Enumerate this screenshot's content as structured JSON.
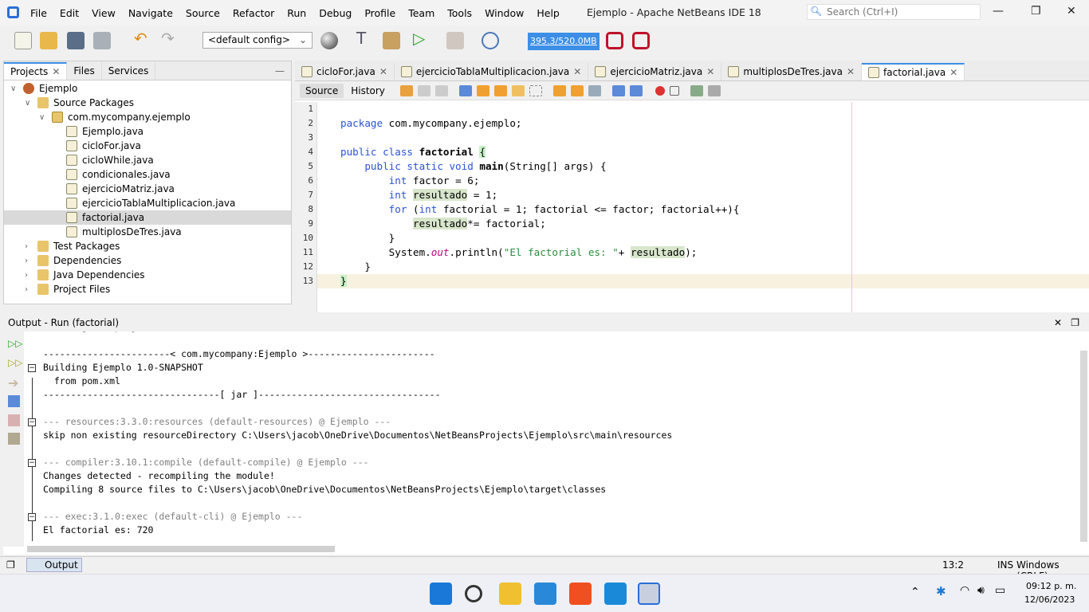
{
  "window": {
    "title": "Ejemplo - Apache NetBeans IDE 18",
    "search_placeholder": "Search (Ctrl+I)"
  },
  "menu": [
    "File",
    "Edit",
    "View",
    "Navigate",
    "Source",
    "Refactor",
    "Run",
    "Debug",
    "Profile",
    "Team",
    "Tools",
    "Window",
    "Help"
  ],
  "toolbar": {
    "config": "<default config>",
    "memory": "395.3/520.0MB"
  },
  "left_panel": {
    "tabs": [
      "Projects",
      "Files",
      "Services"
    ],
    "tree": [
      {
        "label": "Ejemplo",
        "level": 0,
        "icon": "project",
        "exp": "v"
      },
      {
        "label": "Source Packages",
        "level": 1,
        "icon": "folder",
        "exp": "v"
      },
      {
        "label": "com.mycompany.ejemplo",
        "level": 2,
        "icon": "package",
        "exp": "v"
      },
      {
        "label": "Ejemplo.java",
        "level": 3,
        "icon": "java"
      },
      {
        "label": "cicloFor.java",
        "level": 3,
        "icon": "java"
      },
      {
        "label": "cicloWhile.java",
        "level": 3,
        "icon": "java"
      },
      {
        "label": "condicionales.java",
        "level": 3,
        "icon": "java"
      },
      {
        "label": "ejercicioMatriz.java",
        "level": 3,
        "icon": "java"
      },
      {
        "label": "ejercicioTablaMultiplicacion.java",
        "level": 3,
        "icon": "java"
      },
      {
        "label": "factorial.java",
        "level": 3,
        "icon": "java",
        "selected": true
      },
      {
        "label": "multiplosDeTres.java",
        "level": 3,
        "icon": "java"
      },
      {
        "label": "Test Packages",
        "level": 1,
        "icon": "folder",
        "exp": ">"
      },
      {
        "label": "Dependencies",
        "level": 1,
        "icon": "folder",
        "exp": ">"
      },
      {
        "label": "Java Dependencies",
        "level": 1,
        "icon": "folder",
        "exp": ">"
      },
      {
        "label": "Project Files",
        "level": 1,
        "icon": "folder",
        "exp": ">"
      }
    ]
  },
  "editor": {
    "tabs": [
      "cicloFor.java",
      "ejercicioTablaMultiplicacion.java",
      "ejercicioMatriz.java",
      "multiplosDeTres.java",
      "factorial.java"
    ],
    "active_tab": 4,
    "source_label": "Source",
    "history_label": "History",
    "lines": [
      [],
      [
        {
          "t": "package ",
          "c": "kw"
        },
        {
          "t": "com.mycompany.ejemplo;"
        }
      ],
      [],
      [
        {
          "t": "public class ",
          "c": "kw"
        },
        {
          "t": "factorial",
          "c": "b"
        },
        {
          "t": " "
        },
        {
          "t": "{",
          "c": "brace"
        }
      ],
      [
        {
          "t": "    public static void ",
          "c": "kw"
        },
        {
          "t": "main",
          "c": "b"
        },
        {
          "t": "(String[] args) {"
        }
      ],
      [
        {
          "t": "        int ",
          "c": "kw"
        },
        {
          "t": "factor = 6;"
        }
      ],
      [
        {
          "t": "        int ",
          "c": "kw"
        },
        {
          "t": "resultado",
          "c": "mark"
        },
        {
          "t": " = 1;"
        }
      ],
      [
        {
          "t": "        for ",
          "c": "kw"
        },
        {
          "t": "("
        },
        {
          "t": "int ",
          "c": "kw"
        },
        {
          "t": "factorial = 1; factorial <= factor; factorial++){"
        }
      ],
      [
        {
          "t": "            "
        },
        {
          "t": "resultado",
          "c": "mark"
        },
        {
          "t": "*= factorial;"
        }
      ],
      [
        {
          "t": "        }"
        }
      ],
      [
        {
          "t": "        System."
        },
        {
          "t": "out",
          "c": "fld"
        },
        {
          "t": ".println("
        },
        {
          "t": "\"El factorial es: \"",
          "c": "str"
        },
        {
          "t": "+ "
        },
        {
          "t": "resultado",
          "c": "mark"
        },
        {
          "t": ");"
        }
      ],
      [
        {
          "t": "    }"
        }
      ],
      [
        {
          "t": "}",
          "c": "brace"
        }
      ]
    ]
  },
  "output": {
    "title": "Output - Run (factorial)",
    "lines": [
      {
        "t": "Scanning for projects..."
      },
      {
        "t": ""
      },
      {
        "t": "-----------------------< com.mycompany:Ejemplo >-----------------------"
      },
      {
        "t": "Building Ejemplo 1.0-SNAPSHOT",
        "fold": true
      },
      {
        "t": "  from pom.xml"
      },
      {
        "t": "--------------------------------[ jar ]---------------------------------"
      },
      {
        "t": ""
      },
      {
        "t": "--- resources:3.3.0:resources (default-resources) @ Ejemplo ---",
        "fold": true,
        "gray": true
      },
      {
        "t": "skip non existing resourceDirectory C:\\Users\\jacob\\OneDrive\\Documentos\\NetBeansProjects\\Ejemplo\\src\\main\\resources"
      },
      {
        "t": ""
      },
      {
        "t": "--- compiler:3.10.1:compile (default-compile) @ Ejemplo ---",
        "fold": true,
        "gray": true
      },
      {
        "t": "Changes detected - recompiling the module!"
      },
      {
        "t": "Compiling 8 source files to C:\\Users\\jacob\\OneDrive\\Documentos\\NetBeansProjects\\Ejemplo\\target\\classes"
      },
      {
        "t": ""
      },
      {
        "t": "--- exec:3.1.0:exec (default-cli) @ Ejemplo ---",
        "fold": true,
        "gray": true
      },
      {
        "t": "El factorial es: 720"
      }
    ]
  },
  "status": {
    "output_tab": "Output",
    "position": "13:2",
    "mode": "INS",
    "line_ending": "Windows (CRLF)"
  },
  "taskbar": {
    "time": "09:12 p. m.",
    "date": "12/06/2023"
  }
}
